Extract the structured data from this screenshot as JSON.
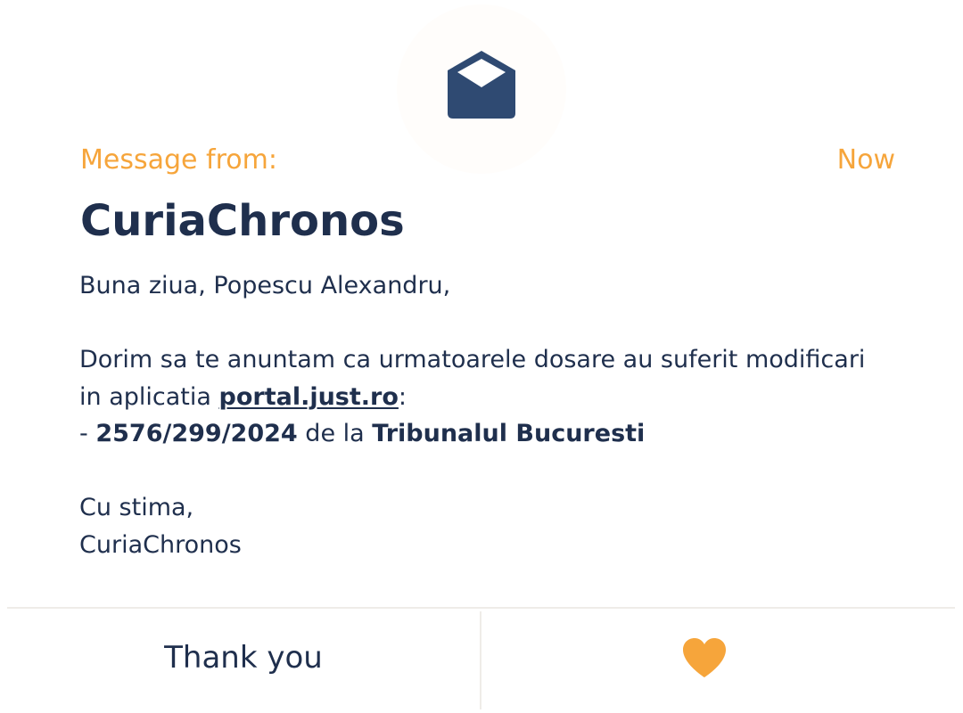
{
  "header": {
    "from_label": "Message from:",
    "time": "Now",
    "sender": "CuriaChronos",
    "icon": "envelope-open-icon"
  },
  "message": {
    "greeting": "Buna ziua, Popescu Alexandru,",
    "intro": "Dorim sa te anuntam ca urmatoarele dosare au suferit modificari in aplicatia ",
    "link": "portal.just.ro",
    "colon": ":",
    "case_prefix": "- ",
    "case_number": "2576/299/2024",
    "case_mid": " de la ",
    "court": "Tribunalul Bucuresti",
    "closing": "Cu stima,",
    "signature": "CuriaChronos"
  },
  "footer": {
    "thank_label": "Thank you",
    "heart_icon": "heart-icon"
  },
  "colors": {
    "accent": "#f6a53b",
    "primary": "#1f2f4d",
    "envelope": "#2f4a72",
    "divider": "#efece8"
  }
}
